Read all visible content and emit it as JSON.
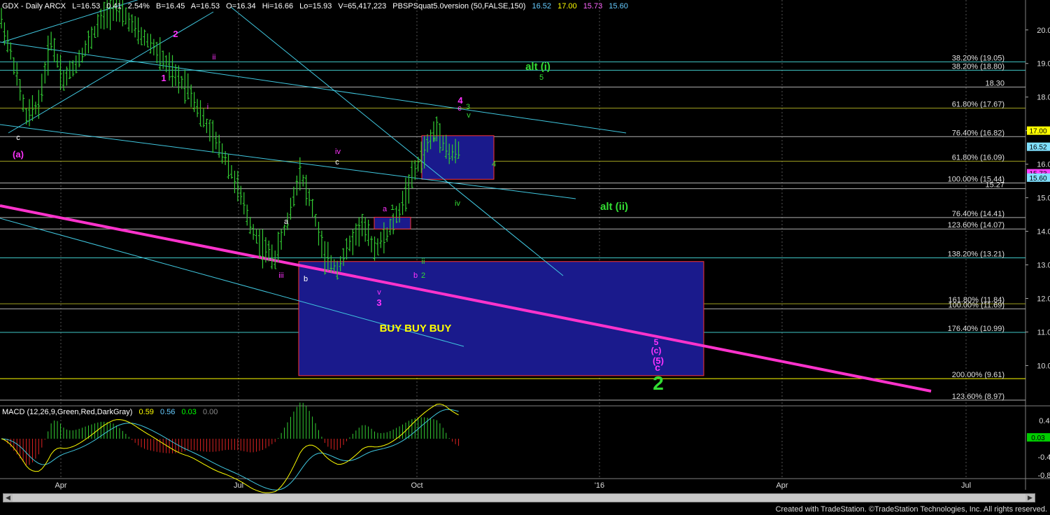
{
  "header": {
    "symbol": "GDX - Daily  ARCX",
    "last": "L=16.53",
    "change": "0.41",
    "change_pct": "2.54%",
    "bid": "B=16.45",
    "ask": "A=16.53",
    "open": "O=16.34",
    "high": "Hi=16.66",
    "low": "Lo=15.93",
    "volume": "V=65,417,223",
    "study": "PBSPSquat5.0version (50,FALSE,150)",
    "study_vals": [
      "16.52",
      "17.00",
      "15.73",
      "15.60"
    ],
    "study_colors": [
      "#66ccff",
      "#ffff00",
      "#ff66ff",
      "#66ccff"
    ]
  },
  "macd": {
    "label": "MACD (12,26,9,Green,Red,DarkGray)",
    "vals": [
      "0.59",
      "0.56",
      "0.03",
      "0.00"
    ],
    "val_colors": [
      "#ffff00",
      "#66ccff",
      "#00ff00",
      "#888888"
    ],
    "ticks": [
      "0.40",
      "0.03",
      "-0.40",
      "-0.80"
    ]
  },
  "footer": "Created with TradeStation. ©TradeStation Technologies, Inc. All rights reserved.",
  "chart_data": {
    "type": "candlestick",
    "title": "GDX - Daily",
    "x_labels": [
      "Apr",
      "Jul",
      "Oct",
      "'16",
      "Apr",
      "Jul"
    ],
    "y_ticks": [
      20,
      19,
      18,
      17,
      16,
      15,
      14,
      13,
      12,
      11,
      10
    ],
    "ylim": [
      8.8,
      20.6
    ],
    "price_path": [
      [
        0,
        20.3
      ],
      [
        4,
        19.0
      ],
      [
        8,
        17.4
      ],
      [
        12,
        17.8
      ],
      [
        16,
        19.7
      ],
      [
        20,
        18.5
      ],
      [
        24,
        19.0
      ],
      [
        28,
        19.6
      ],
      [
        32,
        20.3
      ],
      [
        36,
        20.7
      ],
      [
        40,
        20.4
      ],
      [
        44,
        19.9
      ],
      [
        48,
        19.6
      ],
      [
        52,
        19.1
      ],
      [
        56,
        18.6
      ],
      [
        60,
        18.3
      ],
      [
        64,
        17.5
      ],
      [
        68,
        16.8
      ],
      [
        72,
        16.2
      ],
      [
        76,
        15.3
      ],
      [
        80,
        14.2
      ],
      [
        84,
        13.5
      ],
      [
        88,
        13.2
      ],
      [
        92,
        14.3
      ],
      [
        96,
        15.8
      ],
      [
        100,
        14.7
      ],
      [
        104,
        13.2
      ],
      [
        108,
        12.9
      ],
      [
        112,
        13.6
      ],
      [
        116,
        14.2
      ],
      [
        120,
        13.5
      ],
      [
        124,
        13.9
      ],
      [
        128,
        14.6
      ],
      [
        132,
        15.6
      ],
      [
        136,
        16.4
      ],
      [
        140,
        17.1
      ],
      [
        144,
        16.3
      ],
      [
        148,
        16.4
      ]
    ],
    "hlines": [
      {
        "label": "38.20% (19.05)",
        "value": 19.05,
        "color": "#40c8c8"
      },
      {
        "label": "38.20% (18.80)",
        "value": 18.8,
        "color": "#40c8c8"
      },
      {
        "label": "18.30",
        "value": 18.3,
        "color": "#b0b0b0"
      },
      {
        "label": "61.80% (17.67)",
        "value": 17.67,
        "color": "#a0a020"
      },
      {
        "label": "76.40% (16.82)",
        "value": 16.82,
        "color": "#b0b0b0"
      },
      {
        "label": "61.80% (16.09)",
        "value": 16.09,
        "color": "#a0a020"
      },
      {
        "label": "100.00% (15.44)",
        "value": 15.44,
        "color": "#b0b0b0"
      },
      {
        "label": "15.27",
        "value": 15.27,
        "color": "#b0b0b0"
      },
      {
        "label": "76.40% (14.41)",
        "value": 14.41,
        "color": "#b0b0b0"
      },
      {
        "label": "123.60% (14.07)",
        "value": 14.07,
        "color": "#b0b0b0"
      },
      {
        "label": "138.20% (13.21)",
        "value": 13.21,
        "color": "#40c8c8"
      },
      {
        "label": "161.80% (11.84)",
        "value": 11.84,
        "color": "#a0a020"
      },
      {
        "label": "100.00% (11.69)",
        "value": 11.69,
        "color": "#b0b0b0"
      },
      {
        "label": "176.40% (10.99)",
        "value": 10.99,
        "color": "#40c8c8"
      },
      {
        "label": "200.00% (9.61)",
        "value": 9.61,
        "color": "#ffff00"
      },
      {
        "label": "123.60% (8.97)",
        "value": 8.97,
        "color": "#b0b0b0"
      }
    ],
    "price_tags": [
      {
        "value": 17.0,
        "label": "17.00",
        "bg": "#ffff00",
        "fg": "#000000"
      },
      {
        "value": 16.52,
        "label": "16.52",
        "bg": "#80e0ff",
        "fg": "#000000"
      },
      {
        "value": 15.73,
        "label": "15.73",
        "bg": "#ff40ff",
        "fg": "#000000"
      },
      {
        "value": 15.6,
        "label": "15.60",
        "bg": "#80e0ff",
        "fg": "#000000"
      }
    ],
    "annotations": [
      {
        "text": "alt (i)",
        "color": "#33dd33",
        "size": 15,
        "bold": true
      },
      {
        "text": "alt (ii)",
        "color": "#33dd33",
        "size": 15,
        "bold": true
      },
      {
        "text": "BUY BUY  BUY",
        "color": "#ffff00",
        "size": 15,
        "bold": true
      },
      {
        "text": "(a)",
        "color": "#ff33ff",
        "size": 13,
        "bold": true
      },
      {
        "text": "2",
        "color": "#ff33ff",
        "size": 13,
        "bold": true
      },
      {
        "text": "1",
        "color": "#ff33ff",
        "size": 13,
        "bold": true
      },
      {
        "text": "4",
        "color": "#ff33ff",
        "size": 13,
        "bold": true
      },
      {
        "text": "3",
        "color": "#ff33ff",
        "size": 13,
        "bold": true
      },
      {
        "text": "5",
        "color": "#ff33ff",
        "size": 12,
        "bold": true
      },
      {
        "text": "(c)",
        "color": "#ff33ff",
        "size": 12,
        "bold": true
      },
      {
        "text": "(5)",
        "color": "#ff33ff",
        "size": 13,
        "bold": true
      },
      {
        "text": "c",
        "color": "#ff33ff",
        "size": 14,
        "bold": true
      },
      {
        "text": "2",
        "color": "#33dd33",
        "size": 28,
        "bold": true
      },
      {
        "text": "5",
        "color": "#33dd33",
        "size": 11,
        "bold": false
      },
      {
        "text": "3",
        "color": "#33dd33",
        "size": 11,
        "bold": false
      },
      {
        "text": "v",
        "color": "#33dd33",
        "size": 11,
        "bold": false
      },
      {
        "text": "4",
        "color": "#33dd33",
        "size": 11,
        "bold": false
      },
      {
        "text": "iv",
        "color": "#33dd33",
        "size": 11,
        "bold": false
      },
      {
        "text": "iii",
        "color": "#33dd33",
        "size": 11,
        "bold": false
      },
      {
        "text": "1",
        "color": "#33dd33",
        "size": 11,
        "bold": false
      },
      {
        "text": "2",
        "color": "#33dd33",
        "size": 11,
        "bold": false
      },
      {
        "text": "ii",
        "color": "#33dd33",
        "size": 11,
        "bold": false
      },
      {
        "text": "c",
        "color": "#ff33ff",
        "size": 11,
        "bold": false
      },
      {
        "text": "a",
        "color": "#ff33ff",
        "size": 11,
        "bold": false
      },
      {
        "text": "b",
        "color": "#ff33ff",
        "size": 11,
        "bold": false
      },
      {
        "text": "ii",
        "color": "#ff33ff",
        "size": 11,
        "bold": false
      },
      {
        "text": "i",
        "color": "#ff33ff",
        "size": 11,
        "bold": false
      },
      {
        "text": "iv",
        "color": "#ff33ff",
        "size": 11,
        "bold": false
      },
      {
        "text": "iii",
        "color": "#ff33ff",
        "size": 11,
        "bold": false
      },
      {
        "text": "v",
        "color": "#ff33ff",
        "size": 11,
        "bold": false
      },
      {
        "text": "c",
        "color": "#ffffff",
        "size": 11,
        "bold": false
      },
      {
        "text": "a",
        "color": "#ffffff",
        "size": 11,
        "bold": false
      },
      {
        "text": "b",
        "color": "#ffffff",
        "size": 11,
        "bold": false
      },
      {
        "text": "c",
        "color": "#ffffff",
        "size": 11,
        "bold": false
      }
    ]
  }
}
